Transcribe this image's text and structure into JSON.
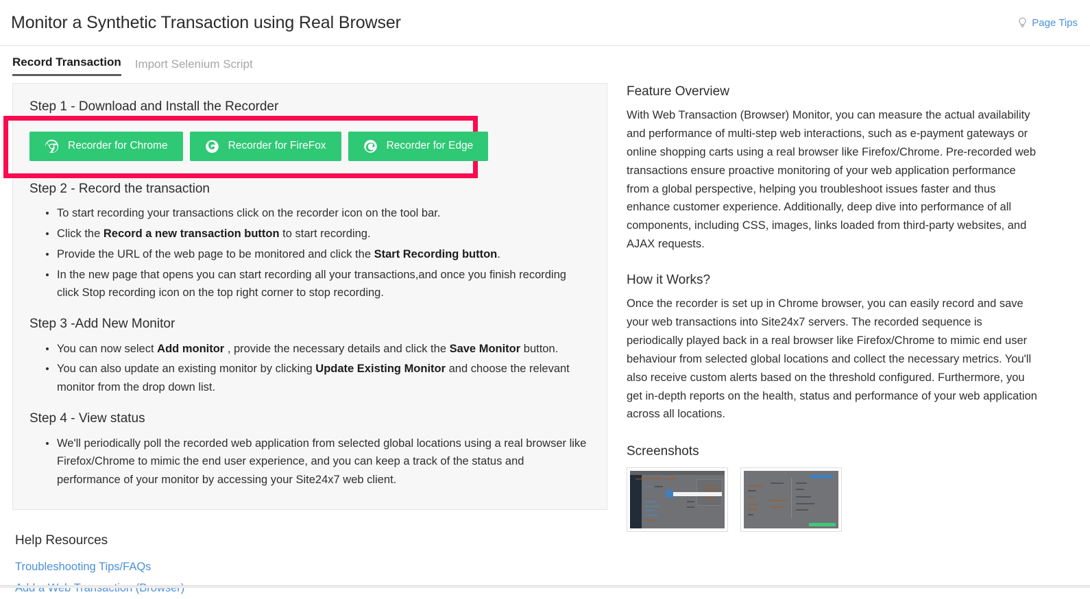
{
  "header": {
    "title": "Monitor a Synthetic Transaction using Real Browser",
    "page_tips_label": "Page Tips",
    "page_tips_icon": "lightbulb-icon"
  },
  "tabs": [
    {
      "label": "Record Transaction",
      "active": true
    },
    {
      "label": "Import Selenium Script",
      "active": false
    }
  ],
  "steps": {
    "step1": {
      "heading": "Step 1 - Download and Install the Recorder",
      "buttons": [
        {
          "label": "Recorder for Chrome",
          "icon": "chrome-icon"
        },
        {
          "label": "Recorder for FireFox",
          "icon": "firefox-icon"
        },
        {
          "label": "Recorder for Edge",
          "icon": "edge-icon"
        }
      ]
    },
    "step2": {
      "heading": "Step 2 - Record the transaction",
      "items": [
        {
          "pre": "To start recording your transactions click on the recorder icon on the tool bar.",
          "bold": "",
          "post": ""
        },
        {
          "pre": "Click the ",
          "bold": "Record a new transaction button",
          "post": " to start recording."
        },
        {
          "pre": "Provide the URL of the web page to be monitored and click the ",
          "bold": "Start Recording button",
          "post": "."
        },
        {
          "pre": "In the new page that opens you can start recording all your transactions,and once you finish recording click Stop recording icon on the top right corner to stop recording.",
          "bold": "",
          "post": ""
        }
      ]
    },
    "step3": {
      "heading": "Step 3 -Add New Monitor",
      "items": [
        {
          "pre": "You can now select ",
          "bold": "Add monitor",
          "post": " , provide the necessary details and click the ",
          "bold2": "Save Monitor",
          "post2": " button."
        },
        {
          "pre": "You can also update an existing monitor by clicking ",
          "bold": "Update Existing Monitor",
          "post": " and choose the relevant monitor from the drop down list."
        }
      ]
    },
    "step4": {
      "heading": "Step 4 - View status",
      "items": [
        {
          "pre": "We'll periodically poll the recorded web application from selected global locations using a real browser like Firefox/Chrome to mimic the end user experience, and you can keep a track of the status and performance of your monitor by accessing your Site24x7 web client.",
          "bold": "",
          "post": ""
        }
      ]
    }
  },
  "help": {
    "title": "Help Resources",
    "links": [
      "Troubleshooting Tips/FAQs",
      "Add a Web Transaction (Browser)"
    ]
  },
  "right": {
    "feature_overview_title": "Feature Overview",
    "feature_overview_text": "With Web Transaction (Browser) Monitor, you can measure the actual availability and performance of multi-step web interactions, such as e-payment gateways or online shopping carts using a real browser like Firefox/Chrome. Pre-recorded web transactions ensure proactive monitoring of your web application performance from a global perspective, helping you troubleshoot issues faster and thus enhance customer experience. Additionally, deep dive into performance of all components, including CSS, images, links loaded from third-party websites, and AJAX requests.",
    "how_it_works_title": "How it Works?",
    "how_it_works_text": "Once the recorder is set up in Chrome browser, you can easily record and save your web transactions into Site24x7 servers. The recorded sequence is periodically played back in a real browser like Firefox/Chrome to mimic end user behaviour from selected global locations and collect the necessary metrics. You'll also receive custom alerts based on the threshold configured. Furthermore, you get in-depth reports on the health, status and performance of your web application across all locations.",
    "screenshots_title": "Screenshots",
    "screenshots": [
      {
        "alt": "product-screenshot-thumbnail-1"
      },
      {
        "alt": "product-screenshot-thumbnail-2"
      }
    ]
  },
  "colors": {
    "accent_green": "#2fc875",
    "highlight_red": "#fb0a50",
    "link_blue": "#4a90d9",
    "panel_bg": "#f7f7f7"
  }
}
